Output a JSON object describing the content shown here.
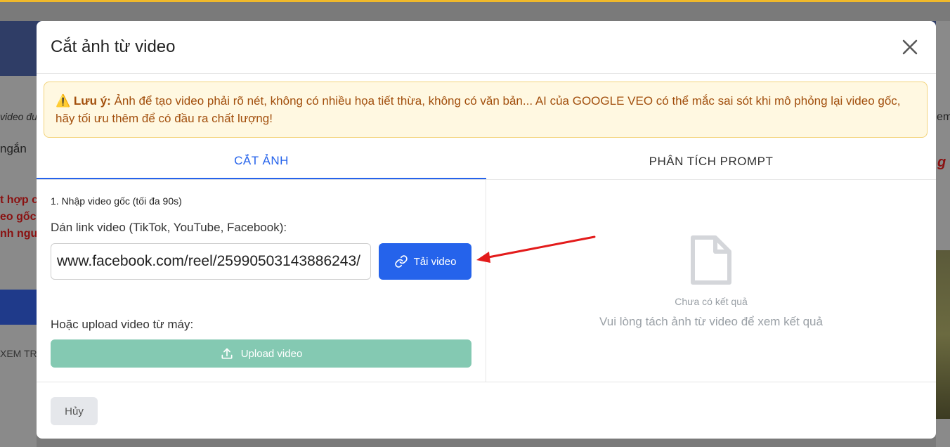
{
  "modal": {
    "title": "Cắt ảnh từ video",
    "alert": {
      "label": "Lưu ý:",
      "text": "Ảnh để tạo video phải rõ nét, không có nhiều họa tiết thừa, không có văn bản... AI của GOOGLE VEO có thể mắc sai sót khi mô phỏng lại video gốc, hãy tối ưu thêm để có đầu ra chất lượng!"
    },
    "tabs": [
      {
        "label": "CẮT ẢNH",
        "active": true
      },
      {
        "label": "PHÂN TÍCH PROMPT",
        "active": false
      }
    ],
    "step_title": "1. Nhập video gốc (tối đa 90s)",
    "link_label": "Dán link video (TikTok, YouTube, Facebook):",
    "link_value": "www.facebook.com/reel/25990503143886243/",
    "download_button": "Tải video",
    "upload_label": "Hoặc upload video từ máy:",
    "upload_button": "Upload video",
    "empty_title": "Chưa có kết quả",
    "empty_subtitle": "Vui lòng tách ảnh từ video để xem kết quả",
    "cancel_button": "Hủy"
  },
  "background": {
    "text1": "video đư",
    "text2": "ngắn",
    "text3": "t hợp c",
    "text4": "eo gốc",
    "text5": "nh ngu",
    "text6": "XEM TRU",
    "right_text1": "em",
    "right_text2": "g"
  },
  "colors": {
    "primary": "#2563eb",
    "upload": "#84c9b2",
    "alert_bg": "#fff8e1",
    "alert_text": "#a24f0d"
  }
}
